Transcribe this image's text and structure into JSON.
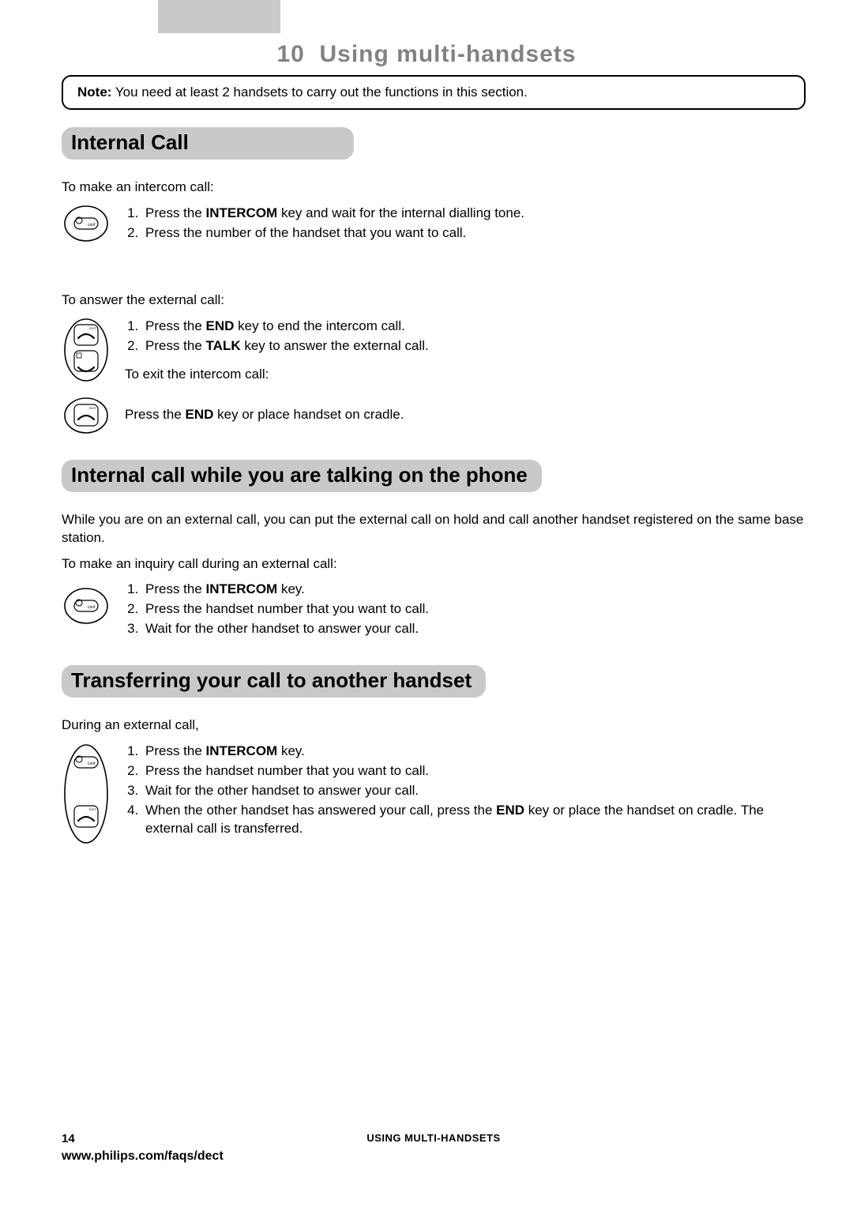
{
  "chapter": {
    "number": "10",
    "title": "Using multi-handsets"
  },
  "note": {
    "label": "Note:",
    "text": " You need at least 2 handsets to carry out the functions in this section."
  },
  "s1": {
    "heading": "Internal Call",
    "intro1": "To make an intercom call:",
    "steps1": [
      "Press the <b>INTERCOM</b> key and wait for the internal dialling tone.",
      "Press the number of the handset that you want to call."
    ],
    "intro2": "To answer the external call:",
    "steps2": [
      "Press the <b>END</b> key to end the intercom call.",
      "Press the <b>TALK</b> key to answer the external call."
    ],
    "intro3": "To exit the intercom call:",
    "step3": "Press the <b>END</b> key or place handset on cradle."
  },
  "s2": {
    "heading": "Internal call while you are talking on the phone",
    "para": "While you are on an external call, you can put the external call on hold and call another handset registered on the same base station.",
    "intro": "To make an inquiry call during an external call:",
    "steps": [
      "Press the <b>INTERCOM</b> key.",
      "Press the handset number that you want to call.",
      "Wait for the other handset to answer your call."
    ]
  },
  "s3": {
    "heading": "Transferring your call to another handset",
    "intro": "During an external call,",
    "steps": [
      "Press the <b>INTERCOM</b> key.",
      "Press the handset number that you want to call.",
      "Wait for the other handset to answer your call.",
      "When the other handset has answered your call, press the <b>END</b> key or place the handset on cradle. The external call is transferred."
    ]
  },
  "footer": {
    "page": "14",
    "section": "Using multi-handsets",
    "url": "www.philips.com/faqs/dect"
  },
  "icons": {
    "intercom": "intercom-key-icon",
    "end": "end-key-icon",
    "talk": "talk-key-icon"
  }
}
